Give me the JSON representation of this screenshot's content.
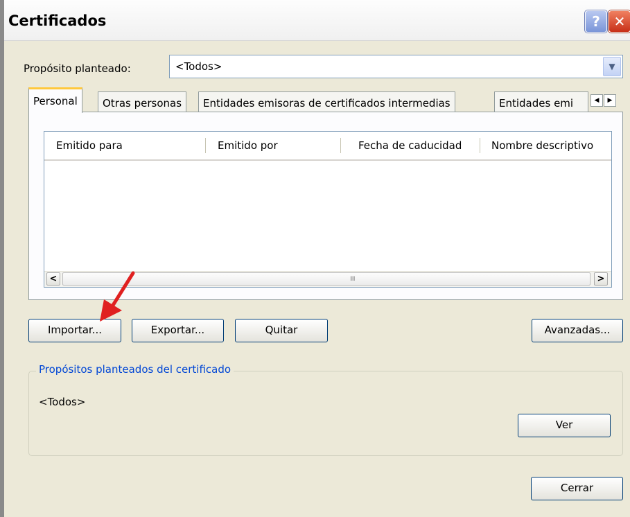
{
  "window": {
    "title": "Certificados",
    "help_label": "?",
    "close_label": "✕"
  },
  "purpose": {
    "label": "Propósito planteado:",
    "value": "<Todos>"
  },
  "tabs": [
    {
      "label": "Personal",
      "active": true
    },
    {
      "label": "Otras personas",
      "active": false
    },
    {
      "label": "Entidades emisoras de certificados intermedias",
      "active": false
    },
    {
      "label": "Entidades emi",
      "active": false
    }
  ],
  "tab_scroll": {
    "left": "◀",
    "right": "▶"
  },
  "list": {
    "columns": [
      "Emitido para",
      "Emitido por",
      "Fecha de caducidad",
      "Nombre descriptivo"
    ],
    "rows": [],
    "scroll_left": "<",
    "scroll_right": ">",
    "thumb_grip": "IIII"
  },
  "buttons": {
    "import": "Importar...",
    "export": "Exportar...",
    "remove": "Quitar",
    "advanced": "Avanzadas...",
    "view": "Ver",
    "close": "Cerrar"
  },
  "group": {
    "legend": "Propósitos planteados del certificado",
    "value": "<Todos>"
  },
  "colors": {
    "accent_tab": "#ffc83c",
    "group_legend": "#0046d5",
    "arrow": "#e02020"
  }
}
